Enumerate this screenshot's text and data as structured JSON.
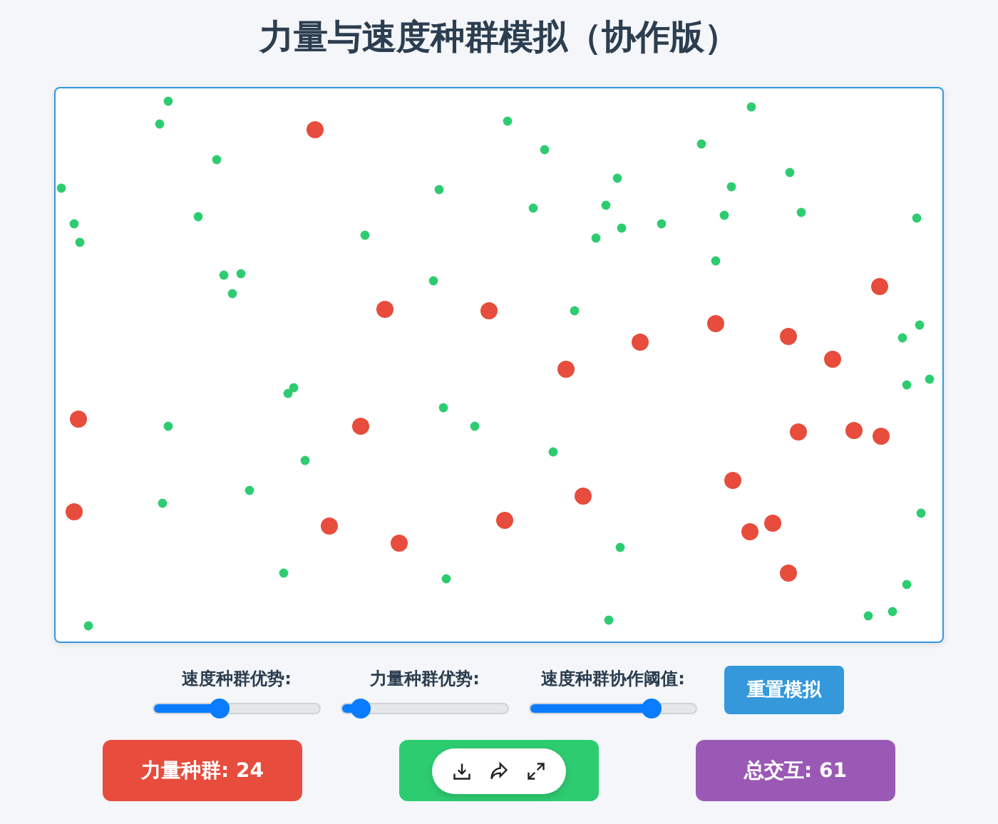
{
  "title": "力量与速度种群模拟（协作版）",
  "sliders": [
    {
      "label": "速度种群优势:",
      "level": 0.4
    },
    {
      "label": "力量种群优势:",
      "level": 0.11
    },
    {
      "label": "速度种群协作阈值:",
      "level": 0.73
    }
  ],
  "reset_button": "重置模拟",
  "stats": [
    {
      "kind": "text",
      "text": "力量种群: 24",
      "color": "#e74c3c"
    },
    {
      "kind": "covered",
      "color": "#2ecc71"
    },
    {
      "kind": "text",
      "text": "总交互: 61",
      "color": "#9b59b6"
    }
  ],
  "overlay_toolbar": {
    "buttons": [
      {
        "kind": "download"
      },
      {
        "kind": "share"
      },
      {
        "kind": "expand"
      }
    ]
  }
}
